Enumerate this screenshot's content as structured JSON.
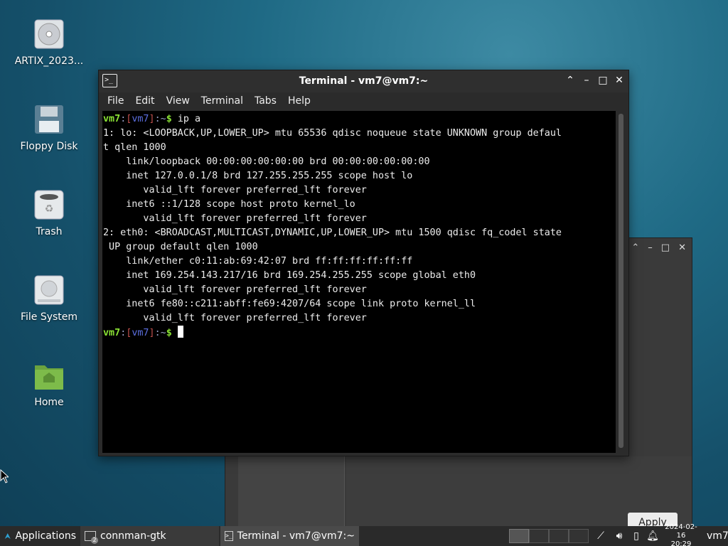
{
  "desktop": {
    "icons": [
      {
        "label": "ARTIX_2023..."
      },
      {
        "label": "Floppy Disk"
      },
      {
        "label": "Trash"
      },
      {
        "label": "File System"
      },
      {
        "label": "Home"
      }
    ]
  },
  "background_window": {
    "apply_label": "Apply"
  },
  "terminal": {
    "title": "Terminal - vm7@vm7:~",
    "menu": [
      "File",
      "Edit",
      "View",
      "Terminal",
      "Tabs",
      "Help"
    ],
    "prompt": {
      "user": "vm7",
      "host": "vm7",
      "dir": "~",
      "symbol": "$"
    },
    "command": "ip a",
    "output": [
      "1: lo: <LOOPBACK,UP,LOWER_UP> mtu 65536 qdisc noqueue state UNKNOWN group defaul",
      "t qlen 1000",
      "    link/loopback 00:00:00:00:00:00 brd 00:00:00:00:00:00",
      "    inet 127.0.0.1/8 brd 127.255.255.255 scope host lo",
      "       valid_lft forever preferred_lft forever",
      "    inet6 ::1/128 scope host proto kernel_lo",
      "       valid_lft forever preferred_lft forever",
      "2: eth0: <BROADCAST,MULTICAST,DYNAMIC,UP,LOWER_UP> mtu 1500 qdisc fq_codel state",
      " UP group default qlen 1000",
      "    link/ether c0:11:ab:69:42:07 brd ff:ff:ff:ff:ff:ff",
      "    inet 169.254.143.217/16 brd 169.254.255.255 scope global eth0",
      "       valid_lft forever preferred_lft forever",
      "    inet6 fe80::c211:abff:fe69:4207/64 scope link proto kernel_ll",
      "       valid_lft forever preferred_lft forever"
    ]
  },
  "taskbar": {
    "apps_label": "Applications",
    "tasks": [
      {
        "label": "connman-gtk",
        "badge": "2"
      },
      {
        "label": "Terminal - vm7@vm7:~"
      }
    ],
    "date": "2024-02-16",
    "time": "20:29",
    "user": "vm7"
  }
}
